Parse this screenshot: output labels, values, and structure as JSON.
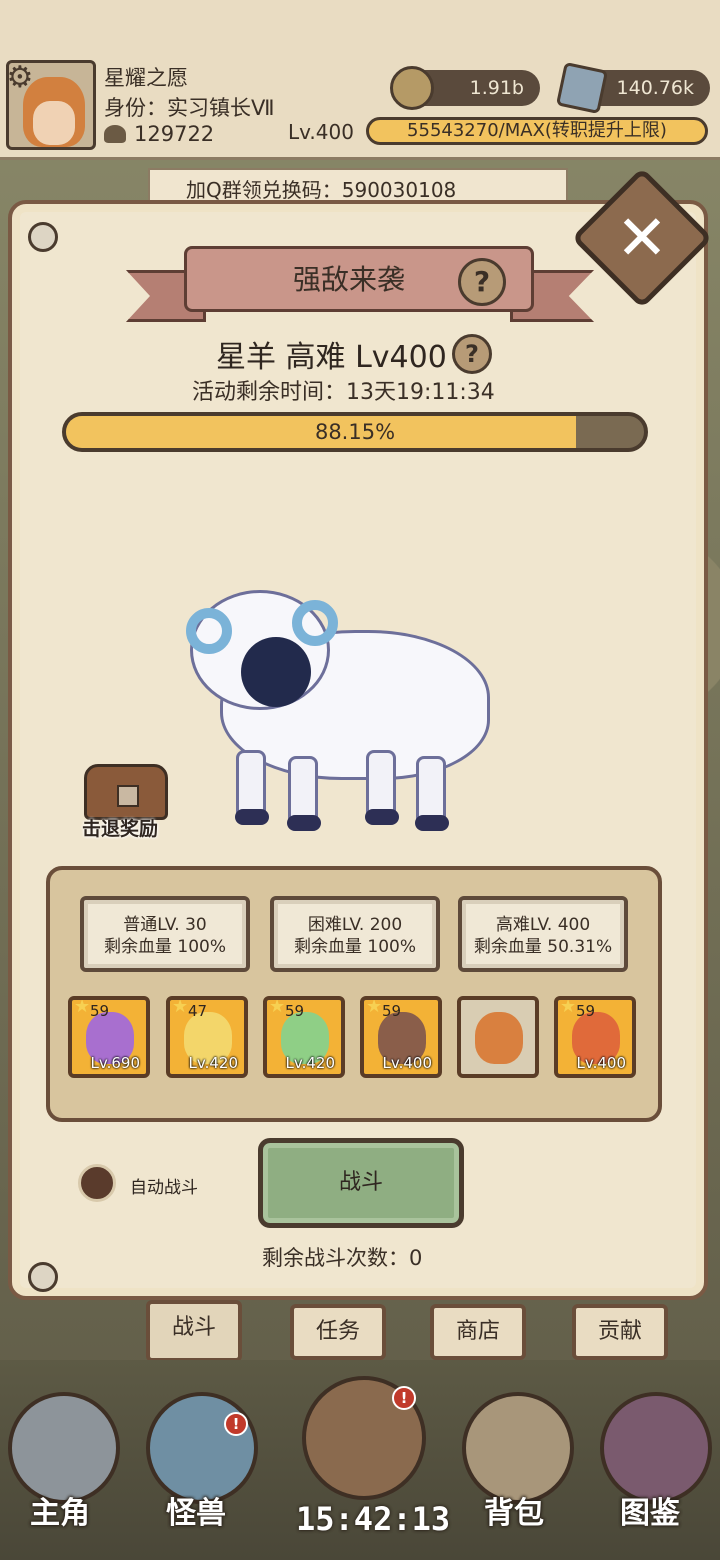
{
  "header": {
    "player_name": "星耀之愿",
    "player_title": "身份：实习镇长Ⅶ",
    "power": "129722",
    "coins": "1.91b",
    "gems": "140.76k",
    "level": "Lv.400",
    "exp": "55543270/MAX(转职提升上限)"
  },
  "notice": "加Q群领兑换码：590030108",
  "event": {
    "title": "强敌来袭",
    "boss": "星羊 高难 Lv400",
    "timer": "活动剩余时间：13天19:11:34",
    "hp_text": "88.15%",
    "hp_fraction": 0.8815,
    "chest_label": "击退奖励"
  },
  "difficulties": [
    {
      "line1": "普通LV. 30",
      "line2": "剩余血量 100%",
      "active": false
    },
    {
      "line1": "困难LV. 200",
      "line2": "剩余血量 100%",
      "active": false
    },
    {
      "line1": "高难LV. 400",
      "line2": "剩余血量 50.31%",
      "active": true
    }
  ],
  "heroes": [
    {
      "stars": "59",
      "level": "Lv.690",
      "color": "#a86fcf"
    },
    {
      "stars": "47",
      "level": "Lv.420",
      "color": "#f3d66a"
    },
    {
      "stars": "59",
      "level": "Lv.420",
      "color": "#8fcf86"
    },
    {
      "stars": "59",
      "level": "Lv.400",
      "color": "#8a5e4a"
    },
    {
      "stars": "",
      "level": "",
      "color": "#d9803f"
    },
    {
      "stars": "59",
      "level": "Lv.400",
      "color": "#e06a3a"
    }
  ],
  "controls": {
    "auto_label": "自动战斗",
    "fight_label": "战斗",
    "remaining": "剩余战斗次数：0"
  },
  "tabs": [
    "战斗",
    "任务",
    "商店",
    "贡献"
  ],
  "nav": {
    "items": [
      "主角",
      "怪兽",
      "背包",
      "图鉴"
    ],
    "badge": "!",
    "clock": "15:42:13"
  },
  "icons": {
    "close": "close-icon",
    "help": "help-icon",
    "settings": "gear-icon"
  }
}
